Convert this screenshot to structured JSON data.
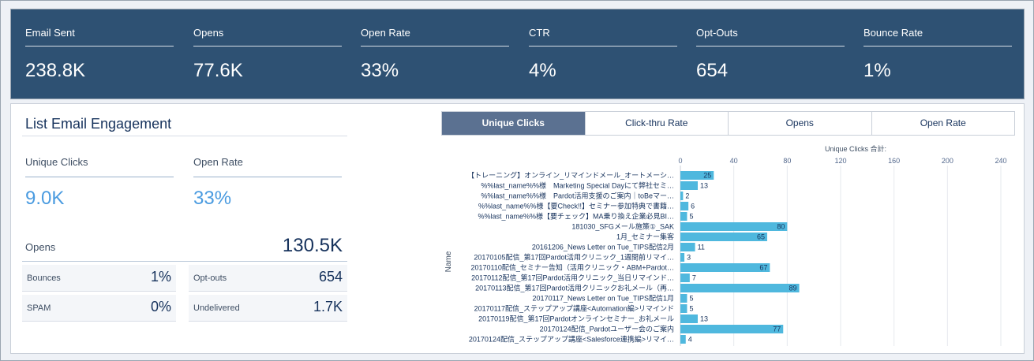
{
  "kpis": [
    {
      "label": "Email Sent",
      "value": "238.8K"
    },
    {
      "label": "Opens",
      "value": "77.6K"
    },
    {
      "label": "Open Rate",
      "value": "33%"
    },
    {
      "label": "CTR",
      "value": "4%"
    },
    {
      "label": "Opt-Outs",
      "value": "654"
    },
    {
      "label": "Bounce Rate",
      "value": "1%"
    }
  ],
  "engagement": {
    "title": "List Email Engagement",
    "unique_clicks": {
      "label": "Unique Clicks",
      "value": "9.0K"
    },
    "open_rate": {
      "label": "Open Rate",
      "value": "33%"
    },
    "opens": {
      "label": "Opens",
      "value": "130.5K"
    },
    "bounces": {
      "label": "Bounces",
      "value": "1%"
    },
    "opt_outs": {
      "label": "Opt-outs",
      "value": "654"
    },
    "spam": {
      "label": "SPAM",
      "value": "0%"
    },
    "undelivered": {
      "label": "Undelivered",
      "value": "1.7K"
    }
  },
  "tabs": [
    {
      "label": "Unique Clicks",
      "active": true
    },
    {
      "label": "Click-thru Rate",
      "active": false
    },
    {
      "label": "Opens",
      "active": false
    },
    {
      "label": "Open Rate",
      "active": false
    }
  ],
  "colors": {
    "header_bg": "#2e5173",
    "bar": "#4fb8de",
    "accent_value": "#4a9be0",
    "active_tab": "#5b7191"
  },
  "chart_data": {
    "type": "bar",
    "orientation": "horizontal",
    "title": "Unique Clicks 合計:",
    "ylabel": "Name",
    "xlim": [
      0,
      240
    ],
    "xticks": [
      0,
      40,
      80,
      120,
      160,
      200,
      240
    ],
    "grid": true,
    "categories": [
      "【トレーニング】オンライン_リマインドメール_オートメーシ…",
      "%%last_name%%様　Marketing Special Dayにて弊社セミ…",
      "%%last_name%%様　Pardot活用支援のご案内｜toBeマー…",
      "%%last_name%%様【要Check!!】セミナー参加特典で書籍…",
      "%%last_name%%様【要チェック】MA乗り換え企業必見BI…",
      "181030_SFGメール施策①_SAK",
      "1月_セミナー集客",
      "20161206_News Letter on Tue_TIPS配信2月",
      "20170105配信_第17回Pardot活用クリニック_1週間前リマイ…",
      "20170110配信_セミナー告知（活用クリニック・ABM+Pardot…",
      "20170112配信_第17回Pardot活用クリニック_当日リマインド…",
      "20170113配信_第17回Pardot活用クリニックお礼メール（再…",
      "20170117_News Letter on Tue_TIPS配信1月",
      "20170117配信_ステップアップ講座<Automation編>リマインド",
      "20170119配信_第17回Pardotオンラインセミナー_お礼メール",
      "20170124配信_Pardotユーザー会のご案内",
      "20170124配信_ステップアップ講座<Salesforce連携編>リマイ…"
    ],
    "values": [
      25,
      13,
      2,
      6,
      5,
      80,
      65,
      11,
      3,
      67,
      7,
      89,
      5,
      5,
      13,
      77,
      4
    ]
  }
}
